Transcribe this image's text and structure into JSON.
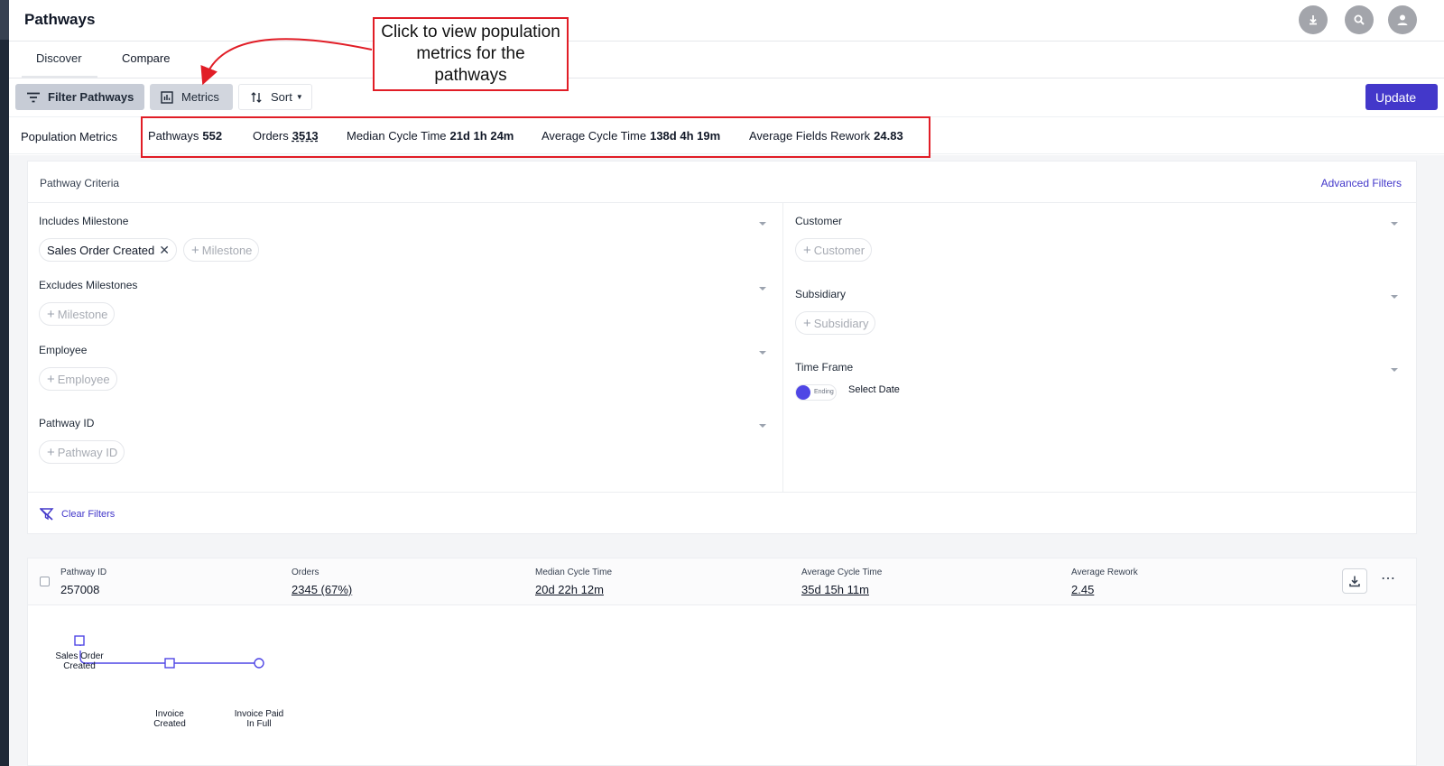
{
  "app": {
    "title": "Pathways",
    "header_icons": [
      "download-icon",
      "search-icon",
      "user-icon"
    ]
  },
  "tabs": [
    {
      "label": "Discover",
      "active": true
    },
    {
      "label": "Compare",
      "active": false
    }
  ],
  "toolbar": {
    "filter_label": "Filter Pathways",
    "metrics_label": "Metrics",
    "sort_label": "Sort",
    "update_label": "Update"
  },
  "population_metrics": {
    "label": "Population Metrics",
    "items": [
      {
        "name": "Pathways",
        "value": "552"
      },
      {
        "name": "Orders",
        "value": "3513"
      },
      {
        "name": "Median Cycle Time",
        "value": "21d 1h 24m"
      },
      {
        "name": "Average Cycle Time",
        "value": "138d 4h 19m"
      },
      {
        "name": "Average Fields Rework",
        "value": "24.83"
      }
    ]
  },
  "criteria": {
    "title": "Pathway Criteria",
    "advanced_filters": "Advanced Filters",
    "includes_milestone": {
      "label": "Includes Milestone",
      "selected": "Sales Order Created",
      "add": "Milestone"
    },
    "excludes_milestones": {
      "label": "Excludes Milestones",
      "add": "Milestone"
    },
    "employee": {
      "label": "Employee",
      "add": "Employee"
    },
    "pathway_id": {
      "label": "Pathway ID",
      "add": "Pathway ID"
    },
    "customer": {
      "label": "Customer",
      "add": "Customer"
    },
    "subsidiary": {
      "label": "Subsidiary",
      "add": "Subsidiary"
    },
    "time_frame": {
      "label": "Time Frame",
      "toggle_label": "Ending",
      "date_placeholder": "Select Date"
    },
    "clear_filters": "Clear Filters"
  },
  "results": {
    "columns": [
      {
        "header": "Pathway ID",
        "value": "257008"
      },
      {
        "header": "Orders",
        "value": "2345 (67%)"
      },
      {
        "header": "Median Cycle Time",
        "value": "20d 22h 12m"
      },
      {
        "header": "Average Cycle Time",
        "value": "35d 15h 11m"
      },
      {
        "header": "Average Rework",
        "value": "2.45"
      }
    ],
    "pathway_nodes": [
      {
        "line1": "Sales Order",
        "line2": "Created"
      },
      {
        "line1": "Invoice",
        "line2": "Created"
      },
      {
        "line1": "Invoice Paid",
        "line2": "In Full"
      }
    ]
  },
  "annotation": {
    "callout_text": "Click to view population metrics for the pathways",
    "color": "#e11d26"
  },
  "colors": {
    "accent": "#4338ca",
    "node": "#4f46e5"
  }
}
